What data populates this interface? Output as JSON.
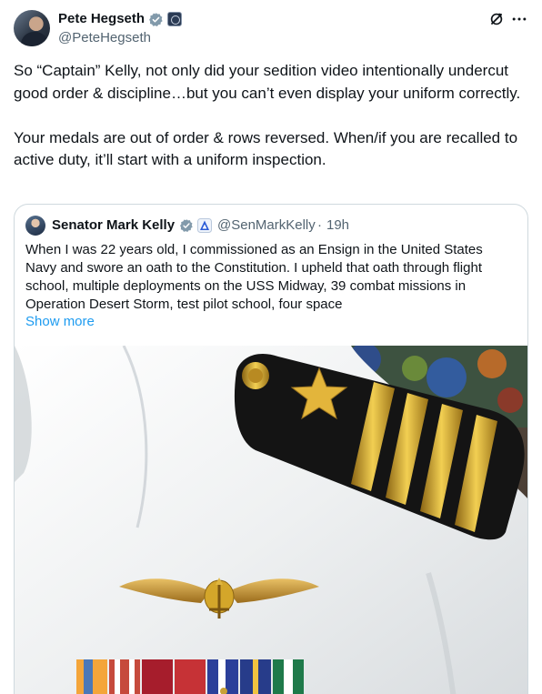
{
  "tweet": {
    "author": {
      "name": "Pete Hegseth",
      "handle": "@PeteHegseth",
      "avatar_icon": "profile-photo",
      "verified_icon": "verified-check-gray-icon",
      "affiliation_icon": "government-seal-icon"
    },
    "actions": {
      "grok_icon": "grok-icon",
      "more_icon": "more-horizontal-icon"
    },
    "text": "So “Captain” Kelly, not only did your sedition video intentionally undercut good order & discipline…but you can’t even display your uniform correctly.\n\nYour medals are out of order & rows reversed. When/if you are recalled to active duty, it’ll start with a uniform inspection."
  },
  "quoted": {
    "author": {
      "name": "Senator Mark Kelly",
      "handle": "@SenMarkKelly",
      "separator": "·",
      "time": "19h",
      "verified_icon": "verified-check-gray-icon",
      "affiliation_icon": "senate-affiliation-icon"
    },
    "text": "When I was 22 years old, I commissioned as an Ensign in the United States Navy and swore an oath to the Constitution. I upheld that oath through flight school, multiple deployments on the USS Midway, 39 combat missions in Operation Desert Storm, test pilot school, four space",
    "show_more": "Show more",
    "media": {
      "description_icon": "photo-white-uniform-shoulder-board",
      "colors": {
        "uniform": "#eef0f1",
        "shoulder_board": "#141414",
        "gold": "#d4a62a"
      }
    }
  }
}
